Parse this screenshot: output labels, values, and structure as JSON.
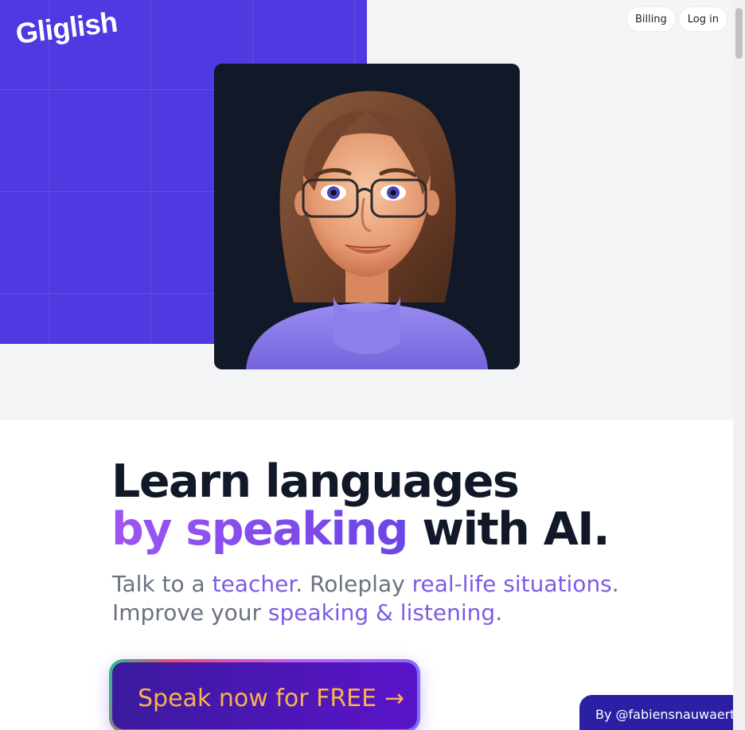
{
  "brand": {
    "logo": "Gliglish"
  },
  "nav": {
    "billing": "Billing",
    "login": "Log in"
  },
  "hero": {
    "avatar_alt": "AI teacher avatar",
    "headline_line1": "Learn languages",
    "headline_grad": "by speaking",
    "headline_rest": " with AI.",
    "sub": [
      {
        "text": "Talk to a ",
        "hl": false
      },
      {
        "text": "teacher",
        "hl": true
      },
      {
        "text": ". Roleplay ",
        "hl": false
      },
      {
        "text": "real-life situations",
        "hl": true
      },
      {
        "text": ". Improve your ",
        "hl": false
      },
      {
        "text": "speaking & listening",
        "hl": true
      },
      {
        "text": ".",
        "hl": false
      }
    ],
    "cta_label": "Speak now for FREE",
    "cta_arrow": "→"
  },
  "credit": "By @fabiensnauwaert",
  "colors": {
    "brand_purple": "#4f39e0",
    "highlight": "#7c5ce6",
    "cta_text": "#fbb24a"
  }
}
